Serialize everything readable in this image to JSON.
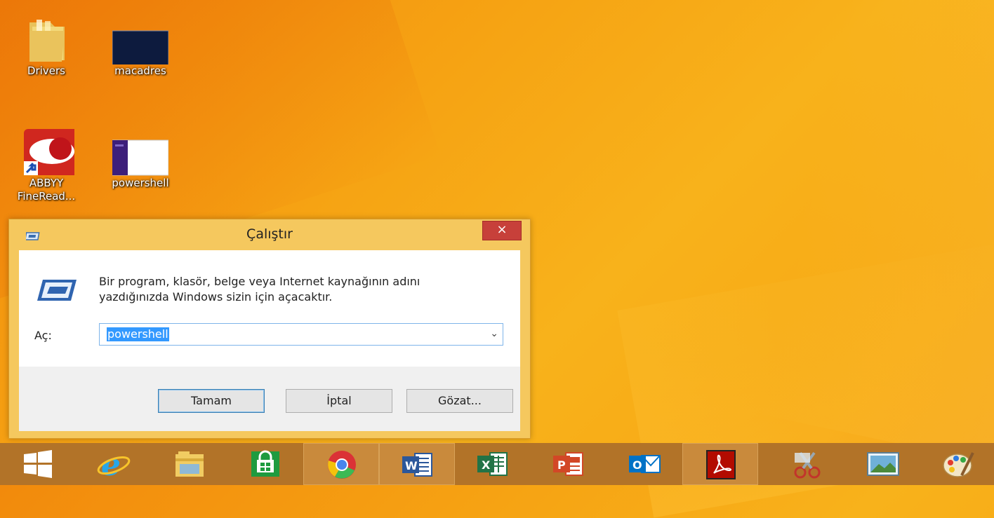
{
  "desktop": {
    "icons": [
      {
        "label": "Drivers"
      },
      {
        "label": "macadres"
      },
      {
        "label": "ABBYY FineRead..."
      },
      {
        "label": "powershell"
      }
    ]
  },
  "run_dialog": {
    "title": "Çalıştır",
    "close_label": "×",
    "description_line1": "Bir program, klasör, belge veya Internet kaynağının adını",
    "description_line2": "yazdığınızda Windows sizin için açacaktır.",
    "open_label": "Aç:",
    "open_value": "powershell",
    "dropdown_arrow": "⌄",
    "ok_label": "Tamam",
    "cancel_label": "İptal",
    "browse_label": "Gözat..."
  },
  "taskbar": {
    "items": [
      "start-icon",
      "internet-explorer-icon",
      "file-explorer-icon",
      "store-icon",
      "chrome-icon",
      "word-icon",
      "excel-icon",
      "powerpoint-icon",
      "outlook-icon",
      "acrobat-icon",
      "snipping-tool-icon",
      "photo-viewer-icon",
      "paint-icon"
    ]
  },
  "colors": {
    "accent": "#f6a313",
    "dialog_frame": "#f5c85e",
    "close_red": "#c7403a",
    "taskbar": "#b27328"
  }
}
